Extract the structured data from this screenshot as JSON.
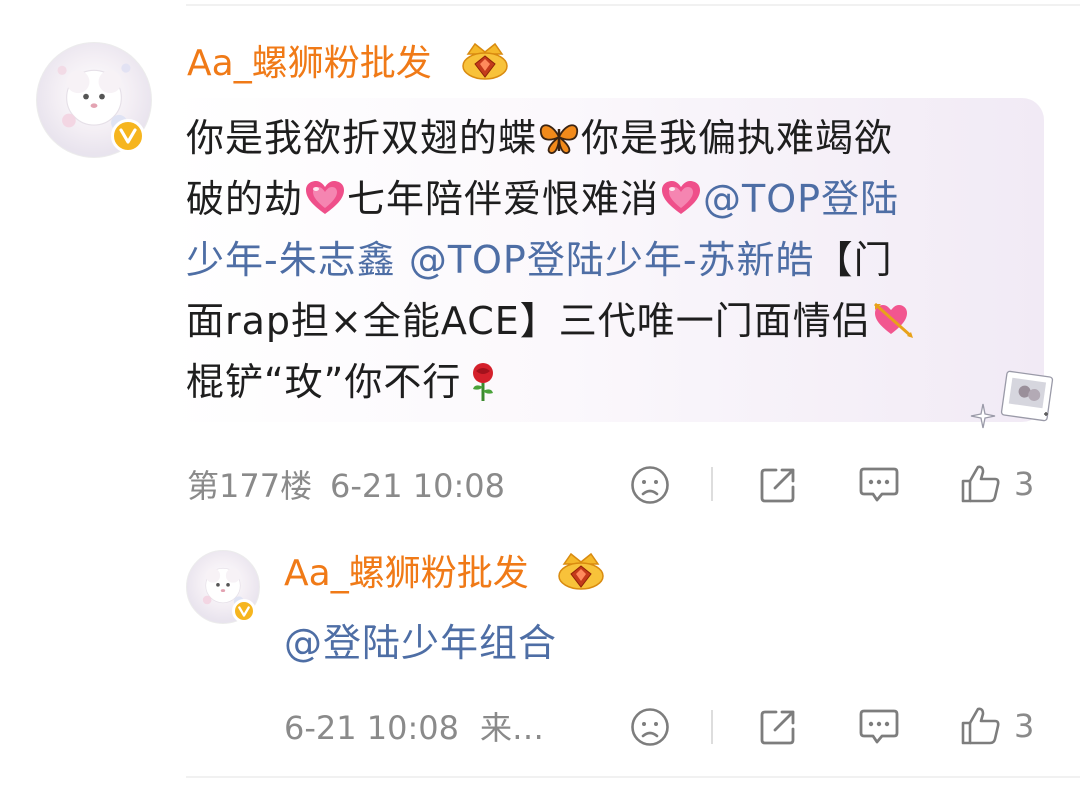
{
  "comment": {
    "username": "Aa_螺狮粉批发",
    "text_line1": "你是我欲折双翅的蝶",
    "text_line1b": "你是我偏执难竭欲",
    "text_line2a": "破的劫",
    "text_line2b": "七年陪伴爱恨难消",
    "mention1": "@TOP登陆",
    "mention1b": "少年-朱志鑫",
    "mention2": "@TOP登陆少年-苏新皓",
    "text_line3b": "【门",
    "text_line4": "面rap担×全能ACE】三代唯一门面情侣",
    "text_line5": "棍铲“玫”你不行",
    "floor": "第177楼",
    "time": "6-21 10:08",
    "like_count": "3"
  },
  "reply": {
    "username": "Aa_螺狮粉批发",
    "text": "@登陆少年组合",
    "time": "6-21 10:08",
    "source": "来…",
    "like_count": "3"
  },
  "icons": {
    "verified": "verified-badge-icon",
    "crown": "crown-badge-icon",
    "dislike": "sad-face-icon",
    "share": "share-icon",
    "comment": "comment-bubble-icon",
    "like": "thumbs-up-icon"
  },
  "colors": {
    "username": "#f07a17",
    "mention": "#4e6ea5",
    "meta": "#8a8a8a",
    "verified": "#f6b51e"
  }
}
